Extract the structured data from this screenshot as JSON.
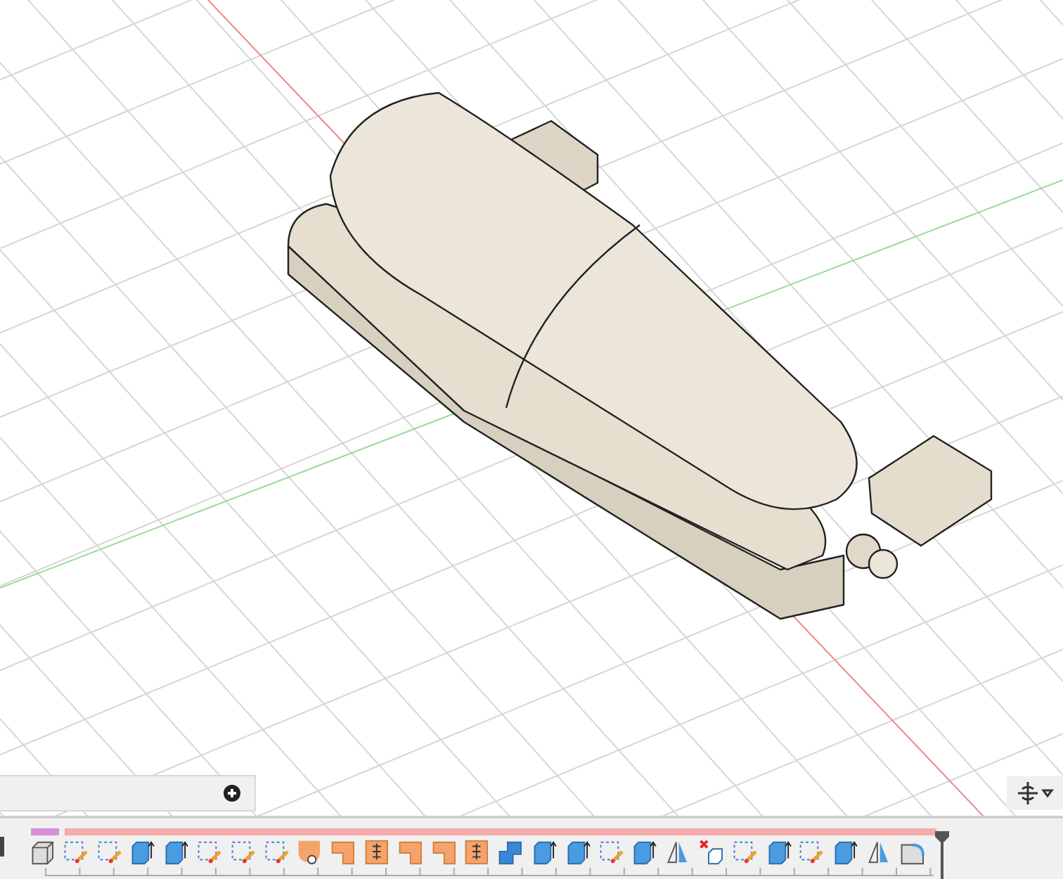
{
  "browser_panel": {
    "expanded": false
  },
  "timeline": {
    "features": [
      {
        "kind": "body"
      },
      {
        "kind": "sketch"
      },
      {
        "kind": "sketch"
      },
      {
        "kind": "extrude"
      },
      {
        "kind": "extrude"
      },
      {
        "kind": "sketch"
      },
      {
        "kind": "sketch"
      },
      {
        "kind": "sketch"
      },
      {
        "kind": "shell"
      },
      {
        "kind": "fillet"
      },
      {
        "kind": "chamfer"
      },
      {
        "kind": "fillet"
      },
      {
        "kind": "fillet"
      },
      {
        "kind": "chamfer"
      },
      {
        "kind": "combine"
      },
      {
        "kind": "extrude"
      },
      {
        "kind": "extrude"
      },
      {
        "kind": "sketch"
      },
      {
        "kind": "extrude"
      },
      {
        "kind": "mirror"
      },
      {
        "kind": "delete"
      },
      {
        "kind": "sketch"
      },
      {
        "kind": "extrude"
      },
      {
        "kind": "sketch"
      },
      {
        "kind": "extrude"
      },
      {
        "kind": "mirror"
      },
      {
        "kind": "round"
      }
    ]
  }
}
